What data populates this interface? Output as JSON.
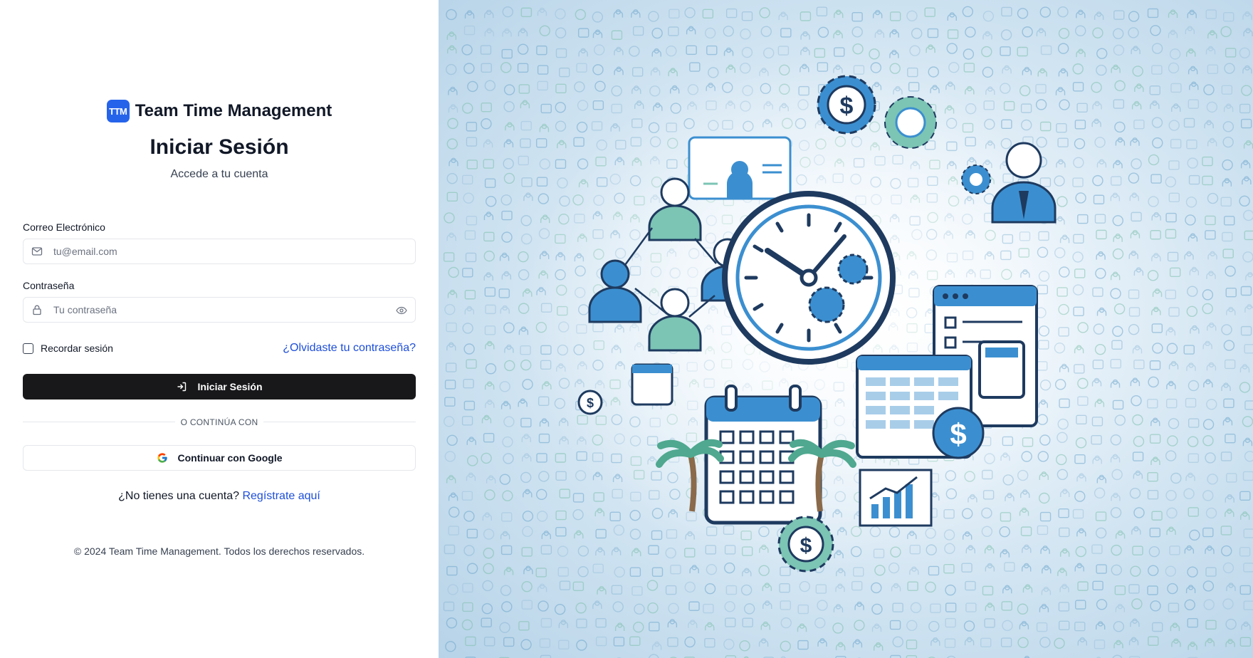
{
  "brand": {
    "badge": "TTM",
    "name": "Team Time Management",
    "accent": "#2563eb"
  },
  "login": {
    "title": "Iniciar Sesión",
    "subtitle": "Accede a tu cuenta",
    "email_label": "Correo Electrónico",
    "email_placeholder": "tu@email.com",
    "email_value": "",
    "password_label": "Contraseña",
    "password_placeholder": "Tu contraseña",
    "password_value": "",
    "remember_label": "Recordar sesión",
    "remember_checked": false,
    "forgot_link": "¿Olvidaste tu contraseña?",
    "submit_label": "Iniciar Sesión",
    "divider_text": "O CONTINÚA CON",
    "google_label": "Continuar con Google",
    "register_prompt": "¿No tienes una cuenta?",
    "register_link": "Regístrate aquí",
    "footer": "© 2024 Team Time Management. Todos los derechos reservados."
  },
  "icons": {
    "email": "mail-icon",
    "password": "lock-icon",
    "show_password": "eye-icon",
    "submit": "login-icon",
    "google": "google-icon"
  },
  "illustration": {
    "subject": "team time management illustration",
    "colors": {
      "primary": "#3b8fd0",
      "secondary": "#7cc4b4",
      "dark": "#1e3a5f"
    }
  }
}
